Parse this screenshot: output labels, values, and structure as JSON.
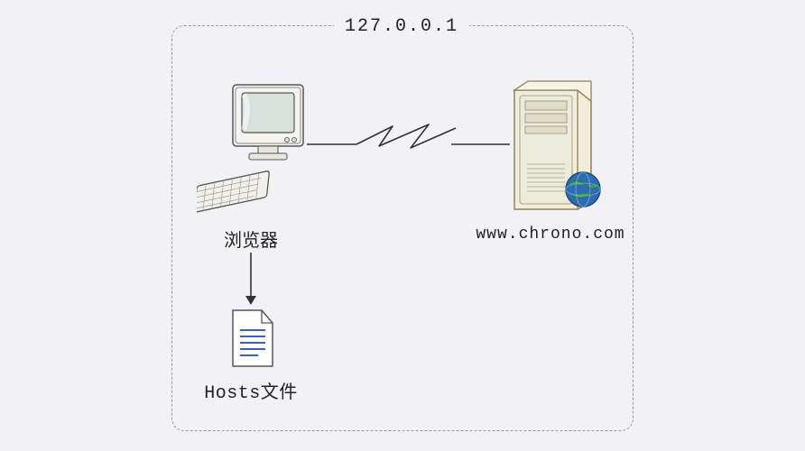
{
  "diagram": {
    "title": "127.0.0.1",
    "nodes": {
      "browser": {
        "label": "浏览器"
      },
      "server": {
        "label": "www.chrono.com"
      },
      "hosts": {
        "label": "Hosts文件"
      }
    },
    "edges": [
      {
        "from": "browser",
        "to": "server",
        "style": "zigzag"
      },
      {
        "from": "browser",
        "to": "hosts",
        "style": "arrow"
      }
    ]
  }
}
